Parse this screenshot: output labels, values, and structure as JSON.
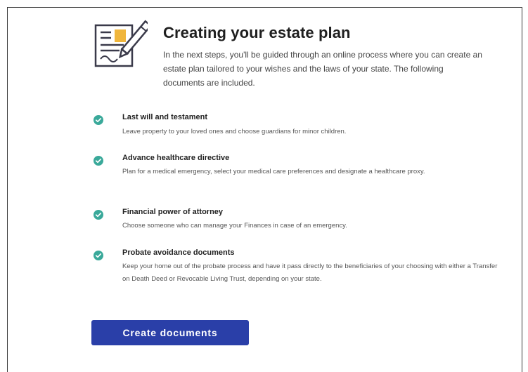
{
  "colors": {
    "accent": "#2a3fa8",
    "check": "#3aa99a",
    "icon_line": "#3a3a4a",
    "icon_fill": "#f0b63c"
  },
  "header": {
    "icon": "document-pen-icon",
    "title": "Creating your estate plan",
    "intro": "In the next steps, you'll be guided through an online process where you can create an estate plan tailored to your wishes and the laws of your state. The following documents are included."
  },
  "documents": [
    {
      "icon": "check-circle-icon",
      "title": "Last will and testament",
      "description": "Leave property to your loved ones and choose guardians for minor children."
    },
    {
      "icon": "check-circle-icon",
      "title": "Advance healthcare directive",
      "description": "Plan for a medical emergency, select your medical care preferences and designate a healthcare proxy."
    },
    {
      "icon": "check-circle-icon",
      "title": "Financial power of attorney",
      "description": "Choose someone who can manage your Finances in case of an emergency."
    },
    {
      "icon": "check-circle-icon",
      "title": "Probate avoidance documents",
      "description": "Keep your home out of the probate process and have it pass directly to the beneficiaries of your choosing with either a Transfer on Death Deed or Revocable Living Trust, depending on your state."
    }
  ],
  "cta": {
    "label": "Create documents"
  }
}
